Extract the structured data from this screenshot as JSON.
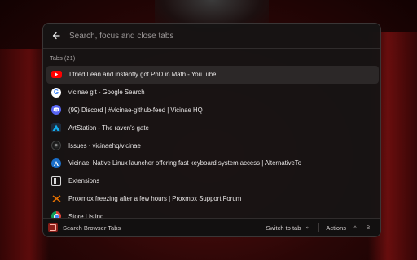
{
  "search": {
    "placeholder": "Search, focus and close tabs",
    "value": ""
  },
  "section": {
    "title": "Tabs (21)"
  },
  "tabs": [
    {
      "title": "I tried Lean and instantly got PhD in Math - YouTube",
      "icon": "youtube-icon",
      "selected": true
    },
    {
      "title": "vicinae git - Google Search",
      "icon": "google-icon",
      "selected": false
    },
    {
      "title": "(99) Discord | #vicinae-github-feed | Vicinae HQ",
      "icon": "discord-icon",
      "selected": false
    },
    {
      "title": "ArtStation - The raven's gate",
      "icon": "artstation-icon",
      "selected": false
    },
    {
      "title": "Issues · vicinaehq/vicinae",
      "icon": "github-icon",
      "selected": false
    },
    {
      "title": "Vicinae: Native Linux launcher offering fast keyboard system access | AlternativeTo",
      "icon": "alternativeto-icon",
      "selected": false
    },
    {
      "title": "Extensions",
      "icon": "extensions-icon",
      "selected": false
    },
    {
      "title": "Proxmox freezing after a few hours | Proxmox Support Forum",
      "icon": "proxmox-icon",
      "selected": false
    },
    {
      "title": "Store Listing",
      "icon": "chrome-icon",
      "selected": false
    }
  ],
  "footer": {
    "command": "Search Browser Tabs",
    "primary_action": "Switch to tab",
    "primary_key": "↵",
    "actions_label": "Actions",
    "actions_key_1": "^",
    "actions_key_2": "B"
  },
  "colors": {
    "youtube": "#ff0000",
    "discord": "#5865f2",
    "artstation": "#13aff0",
    "proxmox": "#e57000",
    "accent_ext": "#8a1f1a"
  }
}
